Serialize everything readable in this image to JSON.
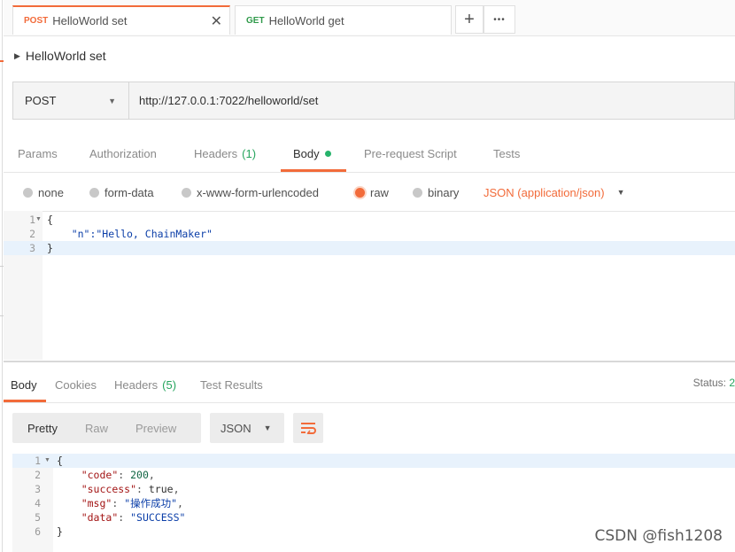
{
  "tabs": [
    {
      "method": "POST",
      "title": "HelloWorld set",
      "close": "✕",
      "method_color": "#f26b3a"
    },
    {
      "method": "GET",
      "title": "HelloWorld get",
      "method_color": "#2f9a4a"
    }
  ],
  "tab_actions": {
    "new": "+",
    "more": "•••"
  },
  "request": {
    "name": "HelloWorld set",
    "method": "POST",
    "url": "http://127.0.0.1:7022/helloworld/set"
  },
  "request_tabs": [
    {
      "label": "Params"
    },
    {
      "label": "Authorization"
    },
    {
      "label": "Headers",
      "count": "(1)"
    },
    {
      "label": "Body"
    },
    {
      "label": "Pre-request Script"
    },
    {
      "label": "Tests"
    }
  ],
  "body_types": [
    {
      "label": "none",
      "selected": false
    },
    {
      "label": "form-data",
      "selected": false
    },
    {
      "label": "x-www-form-urlencoded",
      "selected": false
    },
    {
      "label": "raw",
      "selected": true
    },
    {
      "label": "binary",
      "selected": false
    }
  ],
  "content_type": "JSON (application/json)",
  "request_body": {
    "line_numbers": [
      "1",
      "2",
      "3"
    ],
    "lines": [
      "{",
      "    \"n\":\"Hello, ChainMaker\"",
      "}"
    ]
  },
  "response_tabs": [
    {
      "label": "Body"
    },
    {
      "label": "Cookies"
    },
    {
      "label": "Headers",
      "count": "(5)"
    },
    {
      "label": "Test Results"
    }
  ],
  "status": {
    "label": "Status:",
    "value": "2"
  },
  "response_view": {
    "modes": [
      "Pretty",
      "Raw",
      "Preview"
    ],
    "format": "JSON"
  },
  "response_body": {
    "line_numbers": [
      "1",
      "2",
      "3",
      "4",
      "5",
      "6"
    ],
    "code_key": "\"code\"",
    "code_val": "200",
    "success_key": "\"success\"",
    "success_val": "true",
    "msg_key": "\"msg\"",
    "msg_val": "\"操作成功\"",
    "data_key": "\"data\"",
    "data_val": "\"SUCCESS\""
  },
  "watermark": "CSDN @fish1208",
  "colors": {
    "accent": "#f26b3a",
    "green": "#26a55e"
  },
  "icons": [
    "chevron-right-icon",
    "dropdown-arrow-icon",
    "wrap-lines-icon"
  ]
}
